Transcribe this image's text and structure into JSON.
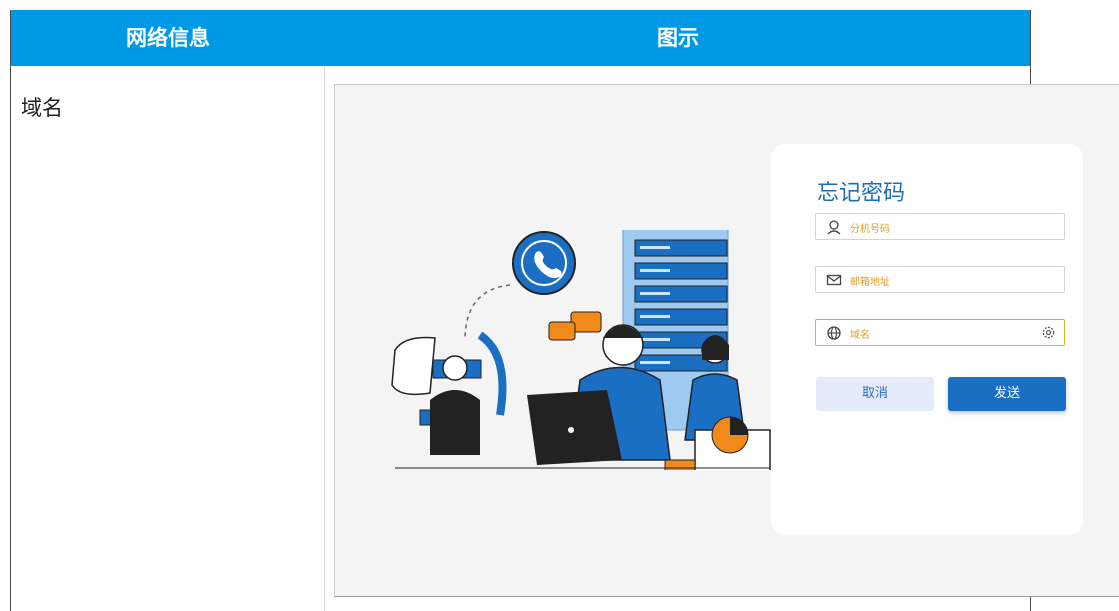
{
  "table": {
    "headers": [
      "网络信息",
      "图示"
    ],
    "row_label": "域名"
  },
  "dialog": {
    "title": "忘记密码",
    "fields": [
      {
        "placeholder": "分机号码",
        "icon": "user-icon"
      },
      {
        "placeholder": "邮箱地址",
        "icon": "mail-icon"
      },
      {
        "placeholder": "域名",
        "icon": "globe-icon",
        "highlighted": true
      }
    ],
    "cancel_label": "取消",
    "send_label": "发送"
  },
  "colors": {
    "header_bg": "#0099e6",
    "accent_blue": "#1b6fc2",
    "highlight_orange": "#f0a818"
  }
}
